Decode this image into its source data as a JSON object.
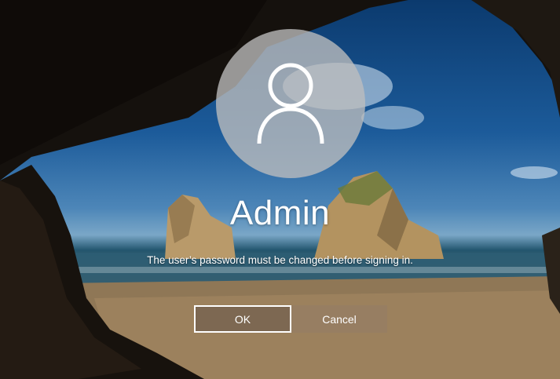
{
  "login": {
    "username": "Admin",
    "message": "The user’s password must be changed before signing in.",
    "ok_label": "OK",
    "cancel_label": "Cancel"
  },
  "icons": {
    "avatar": "user-avatar-icon"
  },
  "colors": {
    "text": "#ffffff",
    "avatar_circle": "#bebebe",
    "button_ok": "#786450",
    "button_cancel": "#967d64",
    "button_focus_border": "#ffffff"
  }
}
